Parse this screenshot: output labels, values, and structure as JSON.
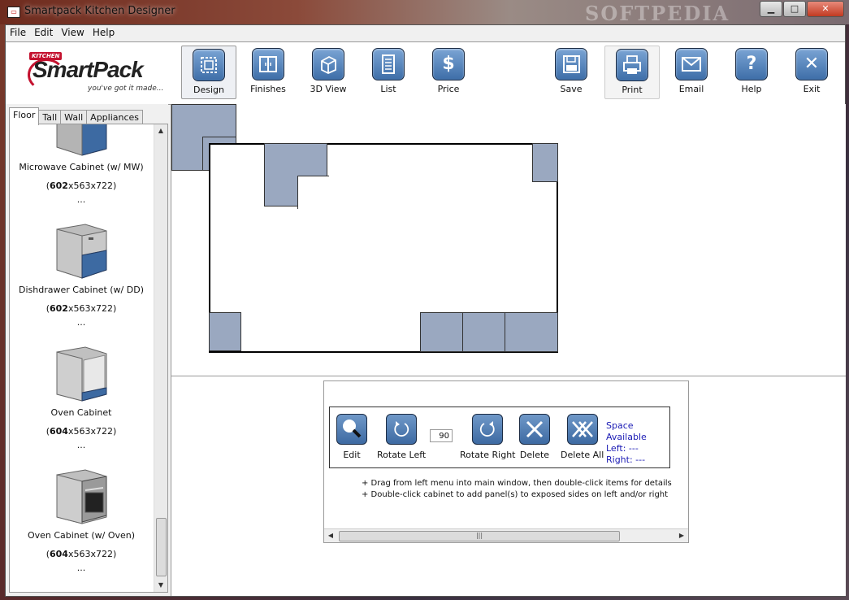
{
  "window": {
    "title": "Smartpack Kitchen Designer",
    "watermark": "SOFTPEDIA",
    "controls": {
      "minimize": "▁",
      "maximize": "□",
      "close": "✕"
    }
  },
  "menu": [
    "File",
    "Edit",
    "View",
    "Help"
  ],
  "logo": {
    "kitchen": "KITCHEN",
    "brand": "SmartPack",
    "tagline": "you've got it made..."
  },
  "toolbar": {
    "design": {
      "label": "Design",
      "icon": "design-icon"
    },
    "finishes": {
      "label": "Finishes",
      "icon": "finishes-icon"
    },
    "view3d": {
      "label": "3D View",
      "icon": "cube-icon"
    },
    "list": {
      "label": "List",
      "icon": "list-icon"
    },
    "price": {
      "label": "Price",
      "icon": "dollar-icon",
      "glyph": "$"
    },
    "save": {
      "label": "Save",
      "icon": "floppy-icon"
    },
    "print": {
      "label": "Print",
      "icon": "printer-icon"
    },
    "email": {
      "label": "Email",
      "icon": "envelope-icon"
    },
    "help": {
      "label": "Help",
      "icon": "question-icon",
      "glyph": "?"
    },
    "exit": {
      "label": "Exit",
      "icon": "close-icon",
      "glyph": "✕"
    }
  },
  "tabs": [
    "Floor",
    "Tall",
    "Wall",
    "Appliances"
  ],
  "catalog": [
    {
      "name": "Microwave Cabinet (w/ MW)",
      "dim_bold": "602",
      "dim_rest": "x563x722",
      "more": "..."
    },
    {
      "name": "Dishdrawer Cabinet (w/ DD)",
      "dim_bold": "602",
      "dim_rest": "x563x722",
      "more": "..."
    },
    {
      "name": "Oven Cabinet",
      "dim_bold": "604",
      "dim_rest": "x563x722",
      "more": "..."
    },
    {
      "name": "Oven Cabinet (w/ Oven)",
      "dim_bold": "604",
      "dim_rest": "x563x722",
      "more": "..."
    }
  ],
  "edit_panel": {
    "edit": "Edit",
    "rotate_left": "Rotate Left",
    "angle": "90",
    "rotate_right": "Rotate Right",
    "delete": "Delete",
    "delete_all": "Delete All",
    "space_title": "Space Available",
    "left": "Left:  ---",
    "right": "Right: ---",
    "hint1": "+ Drag from left menu into main window, then double-click items for details",
    "hint2": "+ Double-click cabinet to add panel(s) to exposed sides on left and/or right"
  },
  "colors": {
    "cabinet": "#9aa8c0",
    "icon_blue": "#3e6ea8",
    "space_text": "#1a1ab4"
  }
}
